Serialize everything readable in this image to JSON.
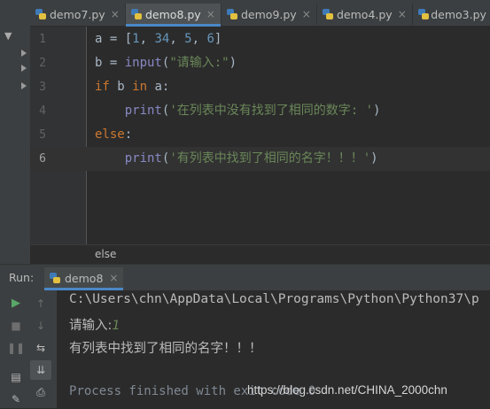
{
  "editor_tabs": [
    {
      "label": "demo7.py",
      "active": false
    },
    {
      "label": "demo8.py",
      "active": true
    },
    {
      "label": "demo9.py",
      "active": false
    },
    {
      "label": "demo4.py",
      "active": false
    },
    {
      "label": "demo3.py",
      "active": false
    }
  ],
  "tab_close_glyph": "×",
  "code_lines": [
    {
      "num": "1",
      "parts": [
        [
          "plain",
          "a = ["
        ],
        [
          "num",
          "1"
        ],
        [
          "plain",
          ", "
        ],
        [
          "num",
          "34"
        ],
        [
          "plain",
          ", "
        ],
        [
          "num",
          "5"
        ],
        [
          "plain",
          ", "
        ],
        [
          "num",
          "6"
        ],
        [
          "plain",
          "]"
        ]
      ]
    },
    {
      "num": "2",
      "parts": [
        [
          "plain",
          "b = "
        ],
        [
          "builtin",
          "input"
        ],
        [
          "plain",
          "("
        ],
        [
          "str",
          "\"请输入:\""
        ],
        [
          "plain",
          ")"
        ]
      ]
    },
    {
      "num": "3",
      "parts": [
        [
          "kw",
          "if"
        ],
        [
          "plain",
          " b "
        ],
        [
          "kw",
          "in"
        ],
        [
          "plain",
          " a:"
        ]
      ]
    },
    {
      "num": "4",
      "parts": [
        [
          "plain",
          "    "
        ],
        [
          "builtin",
          "print"
        ],
        [
          "plain",
          "("
        ],
        [
          "str",
          "'在列表中没有找到了相同的数字: '"
        ],
        [
          "plain",
          ")"
        ]
      ]
    },
    {
      "num": "5",
      "parts": [
        [
          "kw",
          "else"
        ],
        [
          "plain",
          ":"
        ]
      ]
    },
    {
      "num": "6",
      "parts": [
        [
          "plain",
          "    "
        ],
        [
          "builtin",
          "print"
        ],
        [
          "plain",
          "("
        ],
        [
          "str",
          "'有列表中找到了相同的名字！！！'"
        ],
        [
          "plain",
          ")"
        ]
      ]
    }
  ],
  "current_line": "6",
  "breadcrumb": "else",
  "run_panel": {
    "label": "Run:",
    "tab_label": "demo8",
    "console_lines": [
      {
        "type": "path",
        "text": "C:\\Users\\chn\\AppData\\Local\\Programs\\Python\\Python37\\p"
      },
      {
        "type": "prompt",
        "text": "请输入:",
        "input": "1"
      },
      {
        "type": "out",
        "text": "有列表中找到了相同的名字！！！"
      },
      {
        "type": "blank",
        "text": ""
      },
      {
        "type": "process",
        "text": "Process finished with exit code 0"
      }
    ]
  },
  "watermark": "https://blog.csdn.net/CHINA_2000chn",
  "colors": {
    "background": "#2b2b2b",
    "keyword": "#cc7832",
    "number": "#6897bb",
    "string": "#6a8759",
    "builtin": "#8888c6",
    "accent": "#4a88c7"
  }
}
